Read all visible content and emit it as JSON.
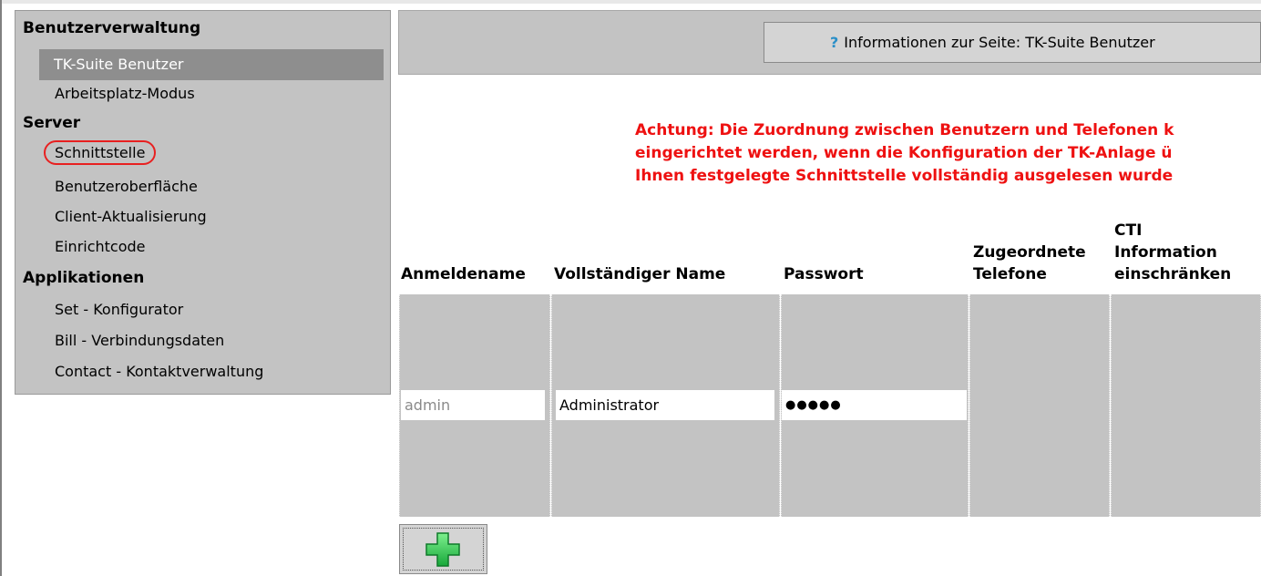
{
  "sidebar": {
    "sections": [
      {
        "heading": "Benutzerverwaltung",
        "items": [
          "TK-Suite Benutzer",
          "Arbeitsplatz-Modus"
        ]
      },
      {
        "heading": "Server",
        "items": [
          "Schnittstelle",
          "Benutzeroberfläche",
          "Client-Aktualisierung",
          "Einrichtcode"
        ]
      },
      {
        "heading": "Applikationen",
        "items": [
          "Set - Konfigurator",
          "Bill - Verbindungsdaten",
          "Contact - Kontaktverwaltung"
        ]
      }
    ],
    "selected_item": "TK-Suite Benutzer",
    "highlighted_item": "Schnittstelle"
  },
  "header": {
    "info_label": "Informationen zur Seite: TK-Suite Benutzer",
    "info_icon": "question-icon"
  },
  "warning": {
    "lines": [
      "Achtung: Die Zuordnung zwischen Benutzern und Telefonen k",
      "eingerichtet werden, wenn die Konfiguration der TK-Anlage ü",
      "Ihnen festgelegte Schnittstelle vollständig ausgelesen wurde"
    ],
    "color": "#ee1111"
  },
  "table": {
    "headers": {
      "login": "Anmeldename",
      "fullname": "Vollständiger Name",
      "password": "Passwort",
      "phones_1": "Zugeordnete",
      "phones_2": "Telefone",
      "cti_1": "CTI",
      "cti_2": "Information",
      "cti_3": "einschränken"
    },
    "rows": [
      {
        "login": "admin",
        "fullname": "Administrator",
        "password": "●●●●●"
      }
    ]
  },
  "add_button": {
    "icon": "plus-icon",
    "color": "#22bb44"
  }
}
